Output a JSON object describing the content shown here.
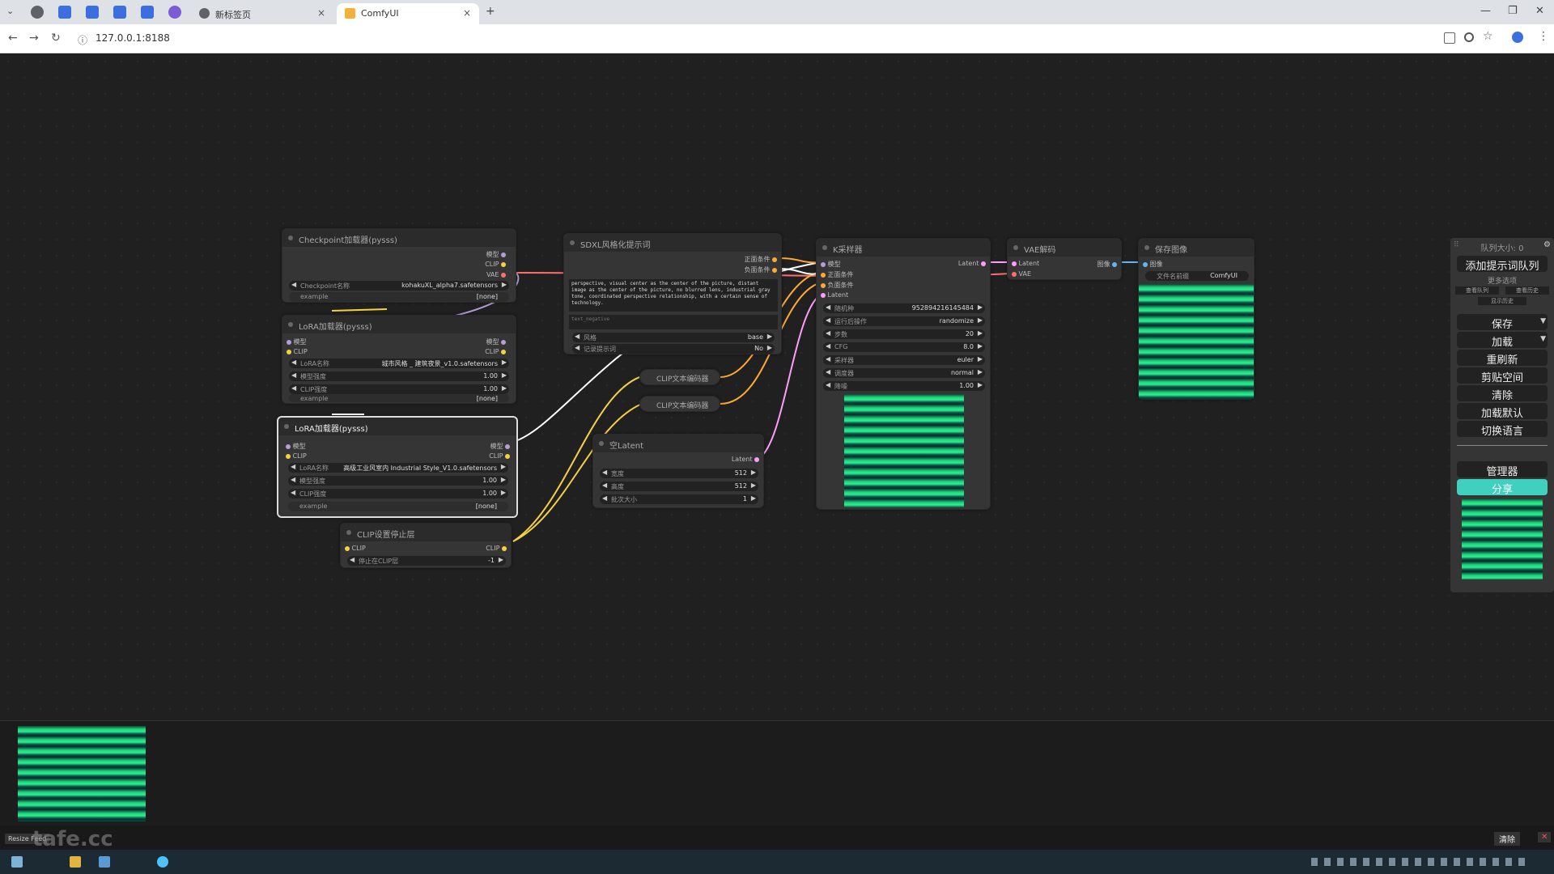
{
  "browser": {
    "tabs": [
      {
        "label": "新标签页",
        "close": "×"
      },
      {
        "label": "ComfyUI",
        "close": "×"
      }
    ],
    "new_tab": "+",
    "url": "127.0.0.1:8188",
    "nav": {
      "back": "←",
      "forward": "→",
      "reload": "↻",
      "info": "ⓘ"
    },
    "window": {
      "min": "—",
      "max": "❐",
      "close": "✕"
    }
  },
  "nodes": {
    "checkpoint": {
      "title": "Checkpoint加载器(pysss)",
      "outputs": [
        "模型",
        "CLIP",
        "VAE"
      ],
      "w_name_label": "Checkpoint名称",
      "w_name_value": "kohakuXL_alpha7.safetensors",
      "w_example_label": "example",
      "w_example_value": "[none]"
    },
    "lora1": {
      "title": "LoRA加载器(pysss)",
      "in_model": "模型",
      "in_clip": "CLIP",
      "out_model": "模型",
      "out_clip": "CLIP",
      "w_name_label": "LoRA名称",
      "w_name_value": "城市风格 _ 建筑夜景_v1.0.safetensors",
      "w_model_label": "模型强度",
      "w_model_value": "1.00",
      "w_clip_label": "CLIP强度",
      "w_clip_value": "1.00",
      "w_example_label": "example",
      "w_example_value": "[none]"
    },
    "lora2": {
      "title": "LoRA加载器(pysss)",
      "in_model": "模型",
      "in_clip": "CLIP",
      "out_model": "模型",
      "out_clip": "CLIP",
      "w_name_label": "LoRA名称",
      "w_name_value": "高级工业风室内 Industrial Style_V1.0.safetensors",
      "w_model_label": "模型强度",
      "w_model_value": "1.00",
      "w_clip_label": "CLIP强度",
      "w_clip_value": "1.00",
      "w_example_label": "example",
      "w_example_value": "[none]"
    },
    "clipstop": {
      "title": "CLIP设置停止层",
      "in_clip": "CLIP",
      "out_clip": "CLIP",
      "w_label": "停止在CLIP层",
      "w_value": "-1"
    },
    "sdxl": {
      "title": "SDXL风格化提示词",
      "out_pos": "正面条件",
      "out_neg": "负面条件",
      "text_pos": "perspective, visual center as the center of the picture, distant image as the center of the picture, no blurred lens, industrial gray tone, coordinated perspective relationship, with a certain sense of technology.",
      "text_neg": "text_negative",
      "w_style_label": "风格",
      "w_style_value": "base",
      "w_log_label": "记录提示词",
      "w_log_value": "No"
    },
    "clipenc1": {
      "title": "CLIP文本编码器"
    },
    "clipenc2": {
      "title": "CLIP文本编码器"
    },
    "latent": {
      "title": "空Latent",
      "out": "Latent",
      "w_w_label": "宽度",
      "w_w_value": "512",
      "w_h_label": "高度",
      "w_h_value": "512",
      "w_b_label": "批次大小",
      "w_b_value": "1"
    },
    "ksampler": {
      "title": "K采样器",
      "in_model": "模型",
      "in_pos": "正面条件",
      "in_neg": "负面条件",
      "in_latent": "Latent",
      "out": "Latent",
      "widgets": [
        {
          "label": "随机种",
          "value": "952894216145484"
        },
        {
          "label": "运行后操作",
          "value": "randomize"
        },
        {
          "label": "步数",
          "value": "20"
        },
        {
          "label": "CFG",
          "value": "8.0"
        },
        {
          "label": "采样器",
          "value": "euler"
        },
        {
          "label": "调度器",
          "value": "normal"
        },
        {
          "label": "降噪",
          "value": "1.00"
        }
      ]
    },
    "vaedecode": {
      "title": "VAE解码",
      "in_latent": "Latent",
      "in_vae": "VAE",
      "out": "图像"
    },
    "saveimage": {
      "title": "保存图像",
      "in_image": "图像",
      "w_label": "文件名前缀",
      "w_value": "ComfyUI"
    }
  },
  "panel": {
    "queue_size": "队列大小: 0",
    "queue_btn": "添加提示词队列",
    "more": "更多选项",
    "sub1": "查看队列",
    "sub2": "查看历史",
    "sub3": "显示历史",
    "save": "保存",
    "load": "加载",
    "refresh": "重刷新",
    "clipspace": "剪贴空间",
    "clear": "清除",
    "load_default": "加载默认",
    "lang": "切换语言",
    "manager": "管理器",
    "share": "分享"
  },
  "feed": {
    "resize": "Resize Feed",
    "clear": "清除",
    "close": "✕"
  },
  "watermark": "tafe.cc",
  "colors": {
    "share": "#3fd0c0",
    "model_link": "#b39ddb",
    "clip_link": "#f5d142",
    "cond_link": "#ffa931",
    "latent_link": "#ff9cf9",
    "vae_link": "#ff6e6e",
    "image_link": "#64b5f6"
  }
}
